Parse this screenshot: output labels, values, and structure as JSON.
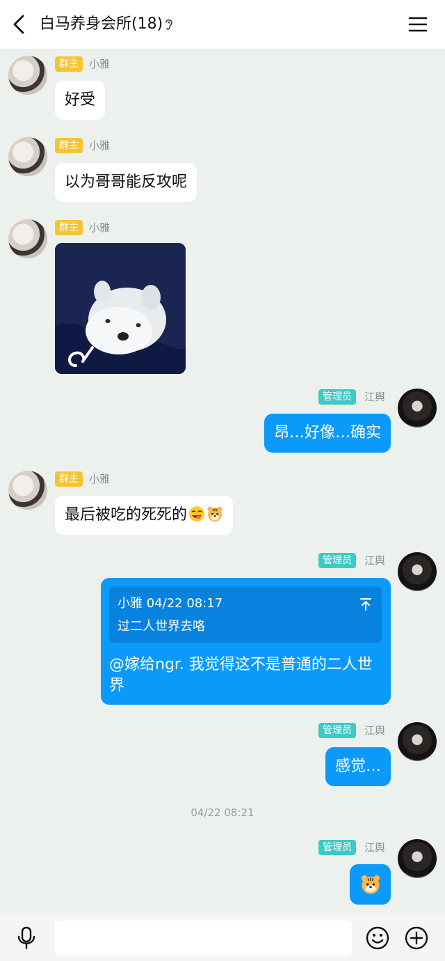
{
  "header": {
    "title": "白马养身会所(18)",
    "back_icon": "chevron-left-icon",
    "ear_icon": "ear-icon",
    "menu_icon": "hamburger-menu-icon"
  },
  "badges": {
    "owner": "群主",
    "admin": "管理员"
  },
  "messages": [
    {
      "sender": "小雅",
      "role": "群主",
      "type": "text",
      "text": "好受"
    },
    {
      "sender": "小雅",
      "role": "群主",
      "type": "text",
      "text": "以为哥哥能反攻呢"
    },
    {
      "sender": "小雅",
      "role": "群主",
      "type": "image",
      "image": "white-puppy-photo"
    },
    {
      "sender": "江舆",
      "role": "管理员",
      "type": "text",
      "text": "昂…好像…确实"
    },
    {
      "sender": "小雅",
      "role": "群主",
      "type": "text",
      "text": "最后被吃的死死的",
      "emojis": [
        "tongue-wink-emoji",
        "tiger-face-emoji"
      ]
    },
    {
      "sender": "江舆",
      "role": "管理员",
      "type": "reply",
      "quote": {
        "meta": "小雅 04/22 08:17",
        "text": "过二人世界去咯"
      },
      "text": "@嫁给ngr. 我觉得这不是普通的二人世界"
    },
    {
      "sender": "江舆",
      "role": "管理员",
      "type": "text",
      "text": "感觉…"
    },
    {
      "sender": "江舆",
      "role": "管理员",
      "type": "sticker",
      "emoji": "tiger-face-emoji"
    }
  ],
  "timestamp": "04/22 08:21",
  "input_bar": {
    "placeholder": "",
    "mic_icon": "microphone-icon",
    "emoji_icon": "smiley-icon",
    "plus_icon": "plus-circle-icon"
  },
  "colors": {
    "background": "#edf1ee",
    "outgoing_bubble": "#0b9afa",
    "owner_badge": "#f7c42e",
    "admin_badge": "#3ec9c4"
  }
}
